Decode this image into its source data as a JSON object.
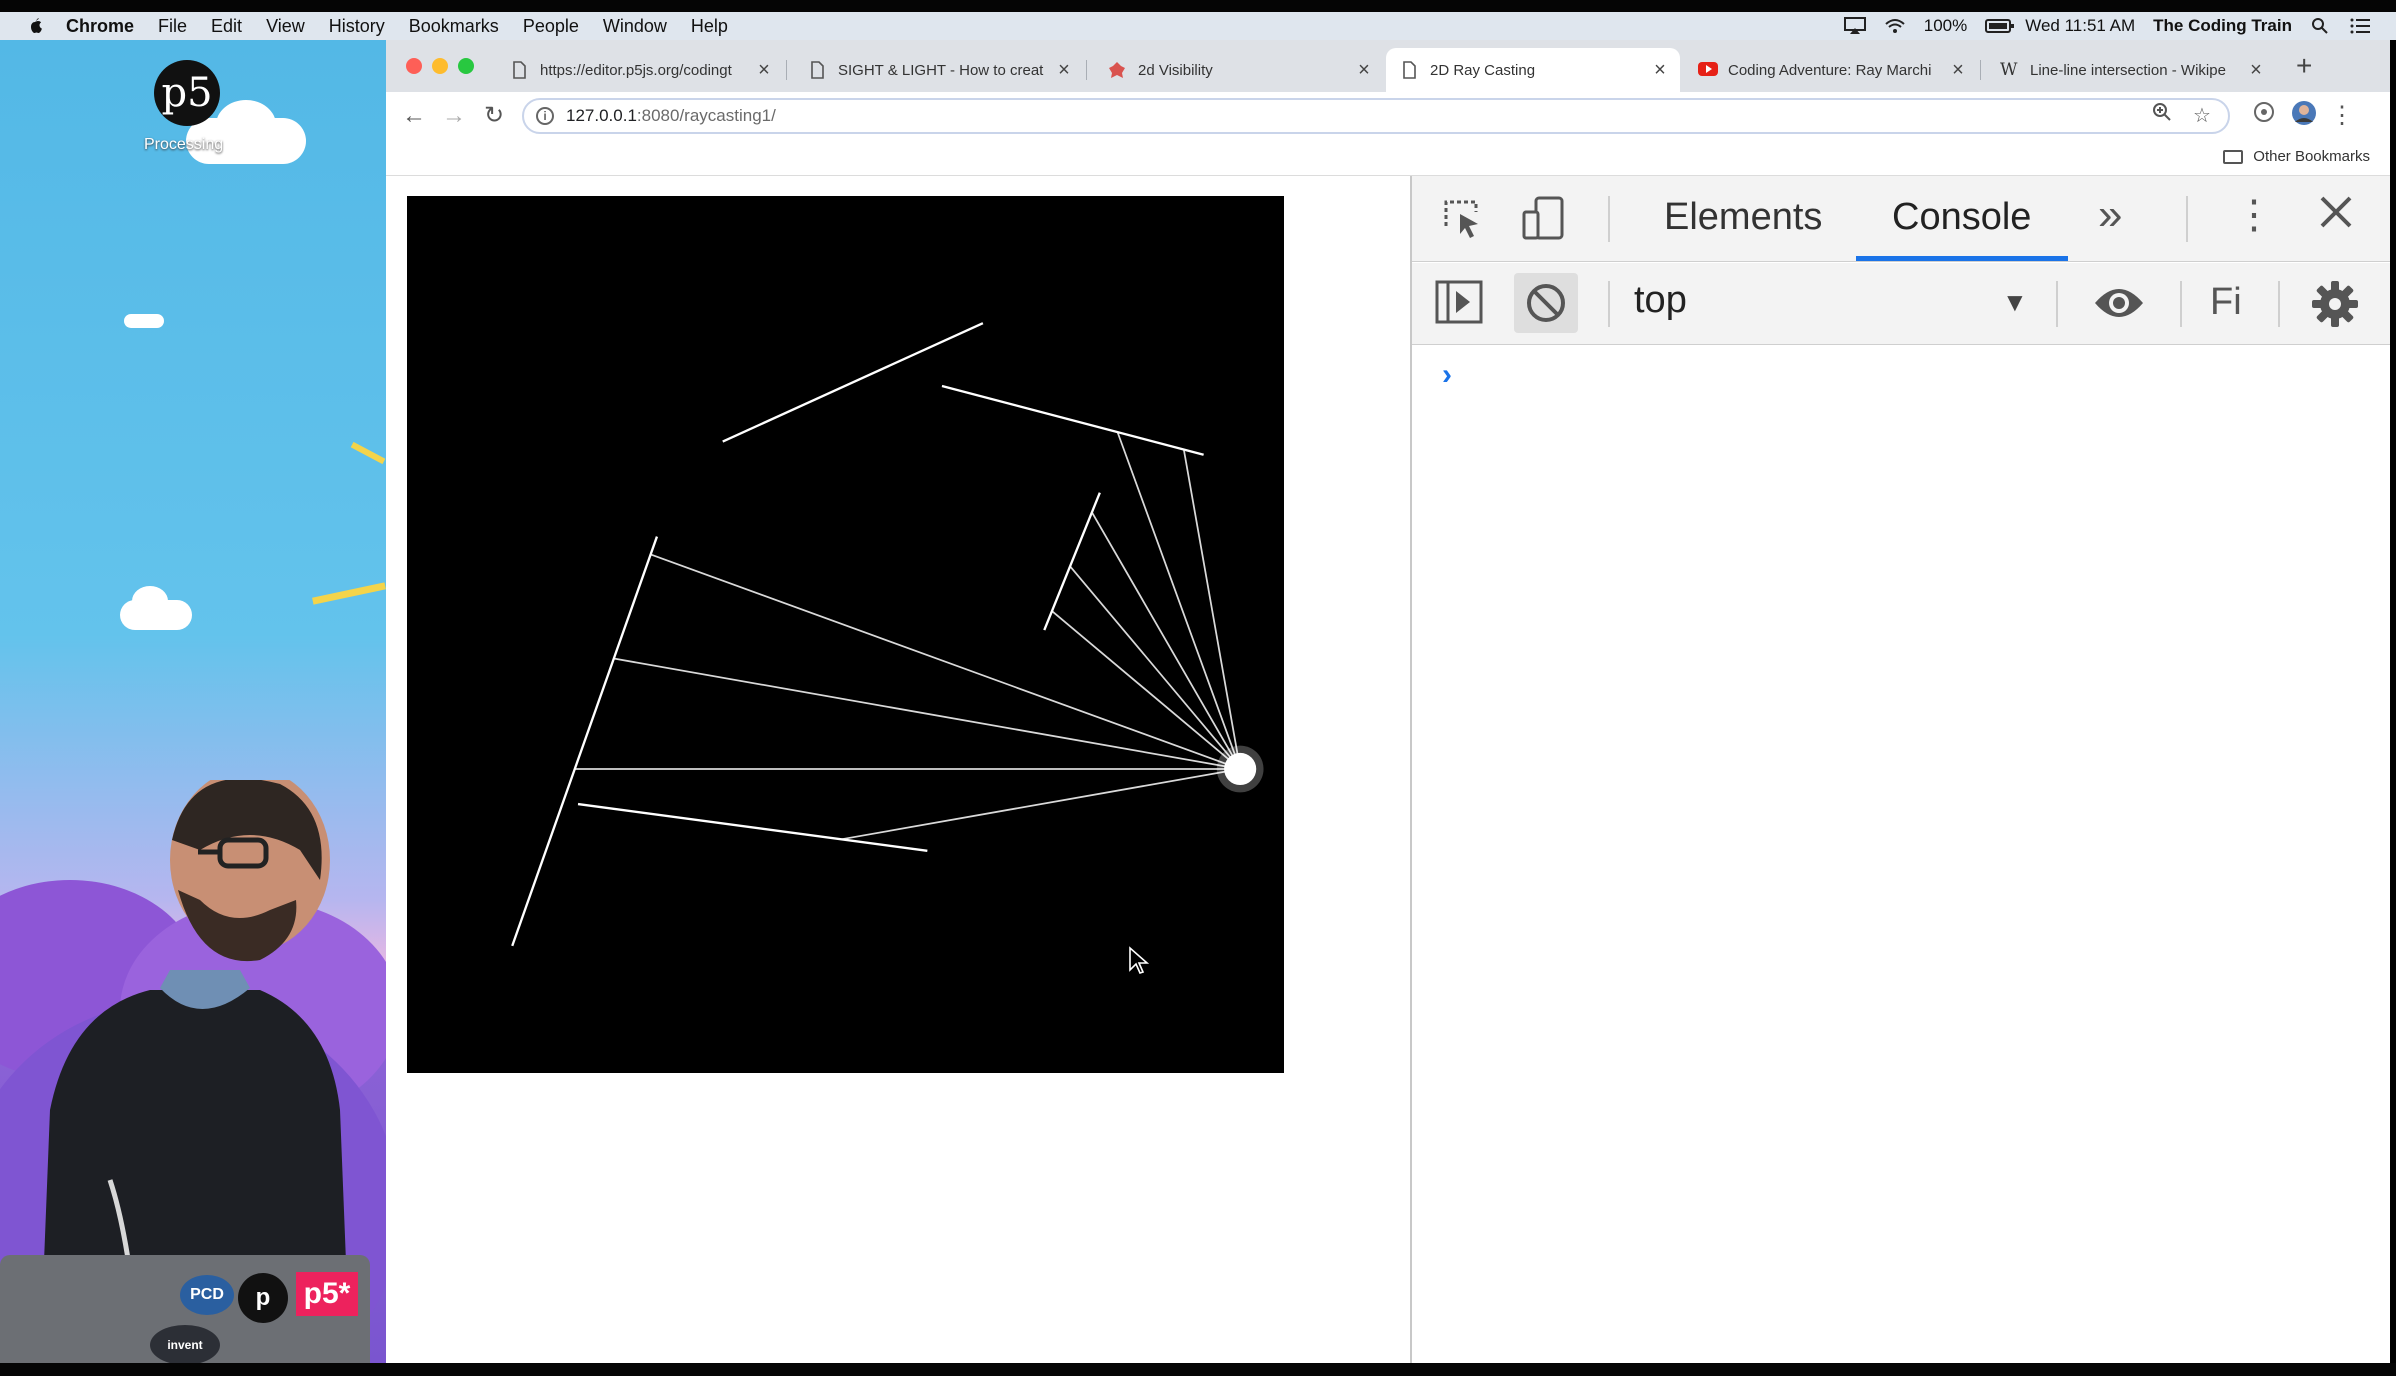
{
  "menubar": {
    "app_name": "Chrome",
    "items": [
      "File",
      "Edit",
      "View",
      "History",
      "Bookmarks",
      "People",
      "Window",
      "Help"
    ],
    "battery": "100%",
    "clock": "Wed 11:51 AM",
    "user": "The Coding Train",
    "icons": [
      "apple-icon",
      "airplay-icon",
      "wifi-icon",
      "battery-icon",
      "spotlight-icon",
      "notification-center-icon"
    ]
  },
  "desktop": {
    "logo_text": "p5",
    "label": "Processing",
    "laptop_sticker": "p5*",
    "accent_color": "#ed225d"
  },
  "browser": {
    "tabs": [
      {
        "title": "https://editor.p5js.org/codingt",
        "icon": "page-icon",
        "active": false
      },
      {
        "title": "SIGHT & LIGHT - How to creat",
        "icon": "page-icon",
        "active": false
      },
      {
        "title": "2d Visibility",
        "icon": "red-blob-icon",
        "active": false
      },
      {
        "title": "2D Ray Casting",
        "icon": "page-icon",
        "active": true
      },
      {
        "title": "Coding Adventure: Ray Marchi",
        "icon": "youtube-icon",
        "active": false
      },
      {
        "title": "Line-line intersection - Wikipe",
        "icon": "wikipedia-icon",
        "active": false
      }
    ],
    "url_host": "127.0.0.1",
    "url_path": ":8080/raycasting1/",
    "other_bookmarks": "Other Bookmarks",
    "new_tab_label": "+"
  },
  "sketch": {
    "background": "#000000",
    "stroke": "#ffffff",
    "light_source": [
      570,
      392
    ],
    "ray_count": 36,
    "walls": [
      [
        [
          171,
          233
        ],
        [
          72,
          513
        ]
      ],
      [
        [
          216,
          168
        ],
        [
          394,
          87
        ]
      ],
      [
        [
          366,
          130
        ],
        [
          545,
          177
        ]
      ],
      [
        [
          474,
          203
        ],
        [
          436,
          297
        ]
      ],
      [
        [
          117,
          416
        ],
        [
          356,
          448
        ]
      ]
    ]
  },
  "devtools": {
    "tabs": [
      "Elements",
      "Console"
    ],
    "active_tab": "Console",
    "more_tabs": "»",
    "context": "top",
    "filter_placeholder": "Fi",
    "prompt": "›",
    "accent": "#1a73e8"
  }
}
